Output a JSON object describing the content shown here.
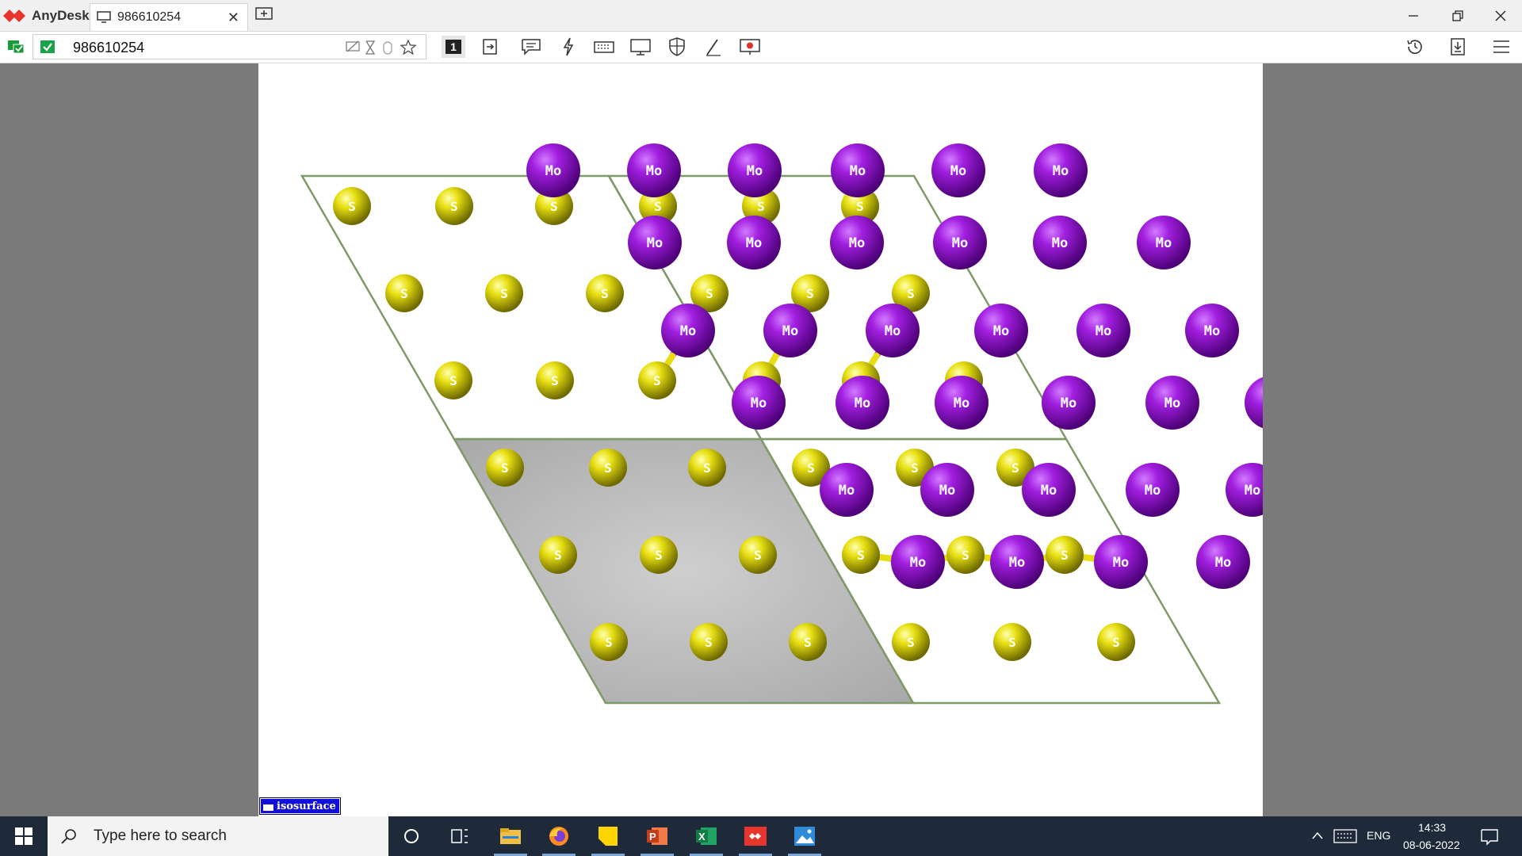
{
  "app": {
    "name": "AnyDesk",
    "tab_label": "986610254",
    "address_value": "986610254",
    "monitor_number": "1"
  },
  "toolbar_icons": [
    "wifi-status-icon",
    "verified-icon",
    "hide-icon",
    "hourglass-icon",
    "mouse-icon",
    "star-icon",
    "monitor-1-button",
    "file-transfer-icon",
    "chat-icon",
    "actions-lightning-icon",
    "keyboard-icon",
    "display-icon",
    "permissions-shield-icon",
    "whiteboard-pen-icon",
    "record-icon",
    "history-icon",
    "download-icon",
    "menu-icon"
  ],
  "viewer": {
    "isosurface_label": "isosurface",
    "atom_labels": {
      "mo": "Mo",
      "s": "S"
    },
    "colors": {
      "mo": "#9a10d6",
      "s": "#e6de12",
      "cell": "#7e9a68"
    }
  },
  "taskbar": {
    "search_placeholder": "Type here to search",
    "apps": [
      "cortana-icon",
      "task-view-icon",
      "file-explorer-icon",
      "firefox-icon",
      "sticky-notes-icon",
      "powerpoint-icon",
      "excel-icon",
      "anydesk-icon",
      "photos-icon"
    ],
    "language": "ENG",
    "time": "14:33",
    "date": "08-06-2022"
  }
}
